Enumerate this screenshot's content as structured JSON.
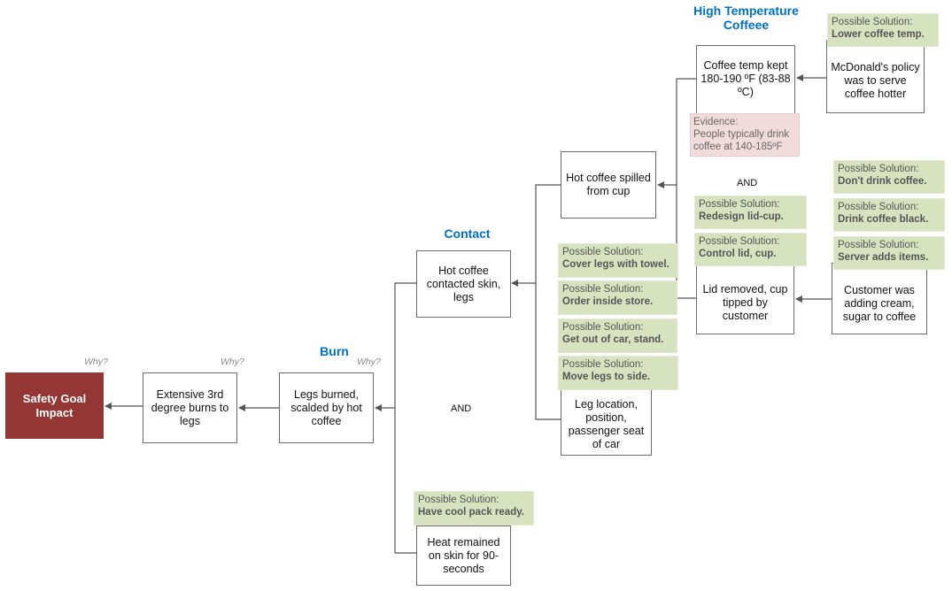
{
  "headings": {
    "burn": "Burn",
    "contact": "Contact",
    "high_temp": "High Temperature Coffeee"
  },
  "why_label": "Why?",
  "and_label": "AND",
  "goal": {
    "label": "Safety Goal Impact",
    "color": "#943634"
  },
  "nodes": {
    "extensive_burns": "Extensive 3rd degree burns to legs",
    "legs_burned": "Legs burned, scalded by hot coffee",
    "contacted_skin": "Hot coffee contacted skin, legs",
    "heat_remained": "Heat remained on skin for 90-seconds",
    "spilled": "Hot coffee spilled from cup",
    "leg_location": "Leg location, position, passenger seat of car",
    "coffee_temp": "Coffee temp kept 180-190 ºF (83-88 ºC)",
    "mcdonalds_policy": "McDonald's policy was to serve coffee hotter",
    "lid_removed": "Lid removed, cup tipped by customer",
    "customer_adding": "Customer was adding cream, sugar to coffee"
  },
  "evidence": {
    "title": "Evidence:",
    "line1": "People typically drink",
    "line2": "coffee at 140-185ºF"
  },
  "solution_prefix": "Possible Solution:",
  "solutions": {
    "lower_temp": "Lower coffee temp.",
    "dont_drink": "Don't drink coffee.",
    "drink_black": "Drink coffee black.",
    "server_adds": "Server adds items.",
    "redesign_lid": "Redesign lid-cup.",
    "control_lid": "Control lid, cup.",
    "cover_legs": "Cover legs with towel.",
    "order_inside": "Order inside store.",
    "get_out": "Get out of car, stand.",
    "move_legs": "Move legs to side.",
    "cool_pack": "Have cool pack ready."
  },
  "colors": {
    "heading": "#0070c0",
    "solution_bg": "#d7e3bf",
    "evidence_bg": "#f2dcdb",
    "connector": "#555555"
  }
}
